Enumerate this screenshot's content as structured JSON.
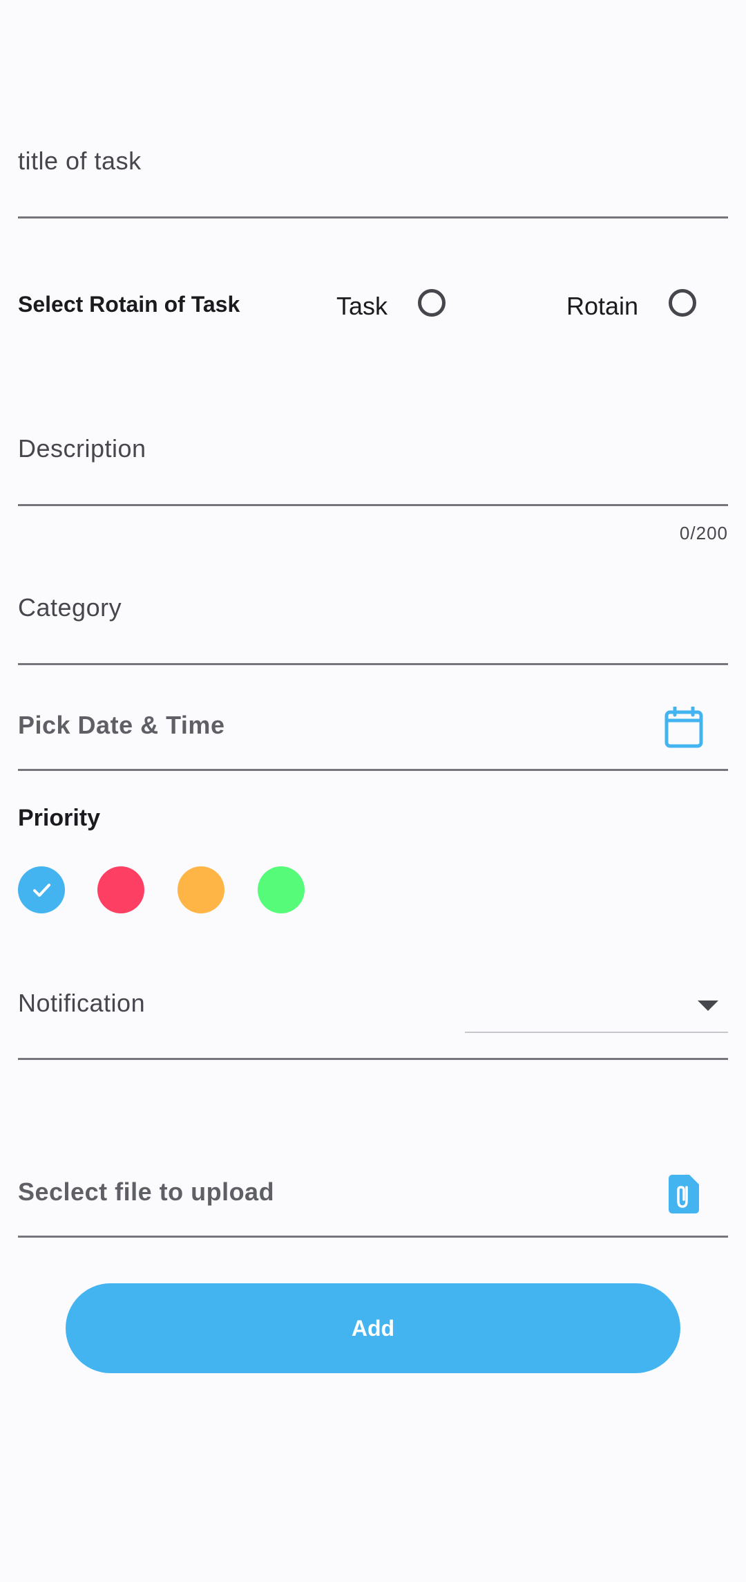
{
  "form": {
    "title_placeholder": "title of task",
    "type_selector": {
      "label": "Select Rotain of Task",
      "option_task": "Task",
      "option_rotain": "Rotain"
    },
    "description_placeholder": "Description",
    "description_counter": "0/200",
    "category_placeholder": "Category",
    "date_time_placeholder": "Pick Date & Time",
    "priority": {
      "label": "Priority",
      "options": [
        {
          "name": "blue",
          "color": "#44b4f1",
          "selected": true
        },
        {
          "name": "red",
          "color": "#fd3f64",
          "selected": false
        },
        {
          "name": "orange",
          "color": "#ffb446",
          "selected": false
        },
        {
          "name": "green",
          "color": "#56fb7a",
          "selected": false
        }
      ]
    },
    "notification_label": "Notification",
    "file_upload_placeholder": "Seclect file to upload",
    "add_button": "Add"
  },
  "colors": {
    "accent": "#44b4f1",
    "background": "#fbfbfd",
    "underline": "#75757b"
  },
  "icons": {
    "date": "calendar-icon",
    "file": "file-attachment-icon",
    "dropdown": "caret-down-icon",
    "check": "check-icon"
  }
}
